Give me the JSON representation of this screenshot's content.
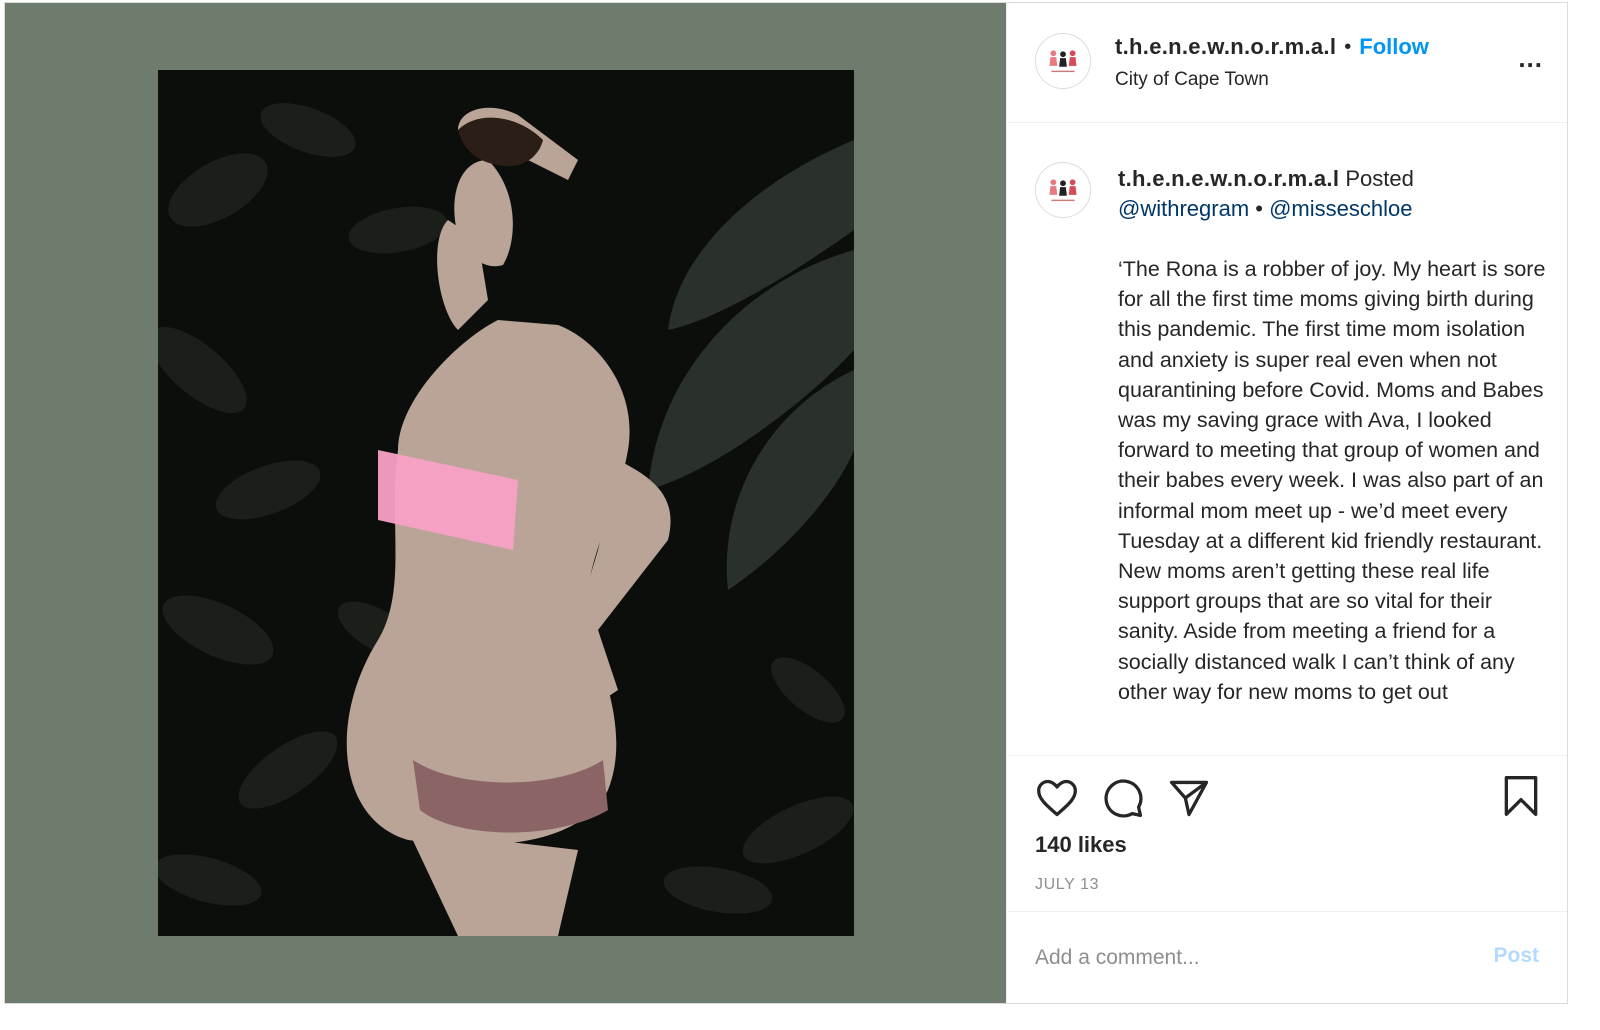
{
  "header": {
    "username": "t.h.e.n.e.w.n.o.r.m.a.l",
    "separator": "•",
    "follow_label": "Follow",
    "location": "City of Cape Town",
    "more_label": "..."
  },
  "caption": {
    "username": "t.h.e.n.e.w.n.o.r.m.a.l",
    "posted_word": "Posted",
    "mention_1": "@withregram",
    "separator": "•",
    "mention_2": "@misseschloe",
    "text": "‘The Rona is a robber of joy. My heart is sore for all the first time moms giving birth during this pandemic. The first time mom isolation and anxiety is super real even when not quarantining before Covid. Moms and Babes was my saving grace with Ava, I looked forward to meeting that group of women and their babes every week. I was also part of an informal mom meet up - we’d meet every Tuesday at a different kid friendly restaurant. New moms aren’t getting these real life support groups that are so vital for their sanity. Aside from meeting a friend for a socially distanced walk I can’t think of any other way for new moms to get out"
  },
  "actions": {
    "icons": [
      "heart-icon",
      "comment-icon",
      "share-icon",
      "bookmark-icon"
    ],
    "likes": "140 likes",
    "date": "JULY 13"
  },
  "comment": {
    "placeholder": "Add a comment...",
    "post_label": "Post"
  },
  "colors": {
    "accent": "#0095f6",
    "media_bg": "#6e7c6e",
    "post_disabled": "#b3dbff",
    "mention": "#00376b"
  }
}
